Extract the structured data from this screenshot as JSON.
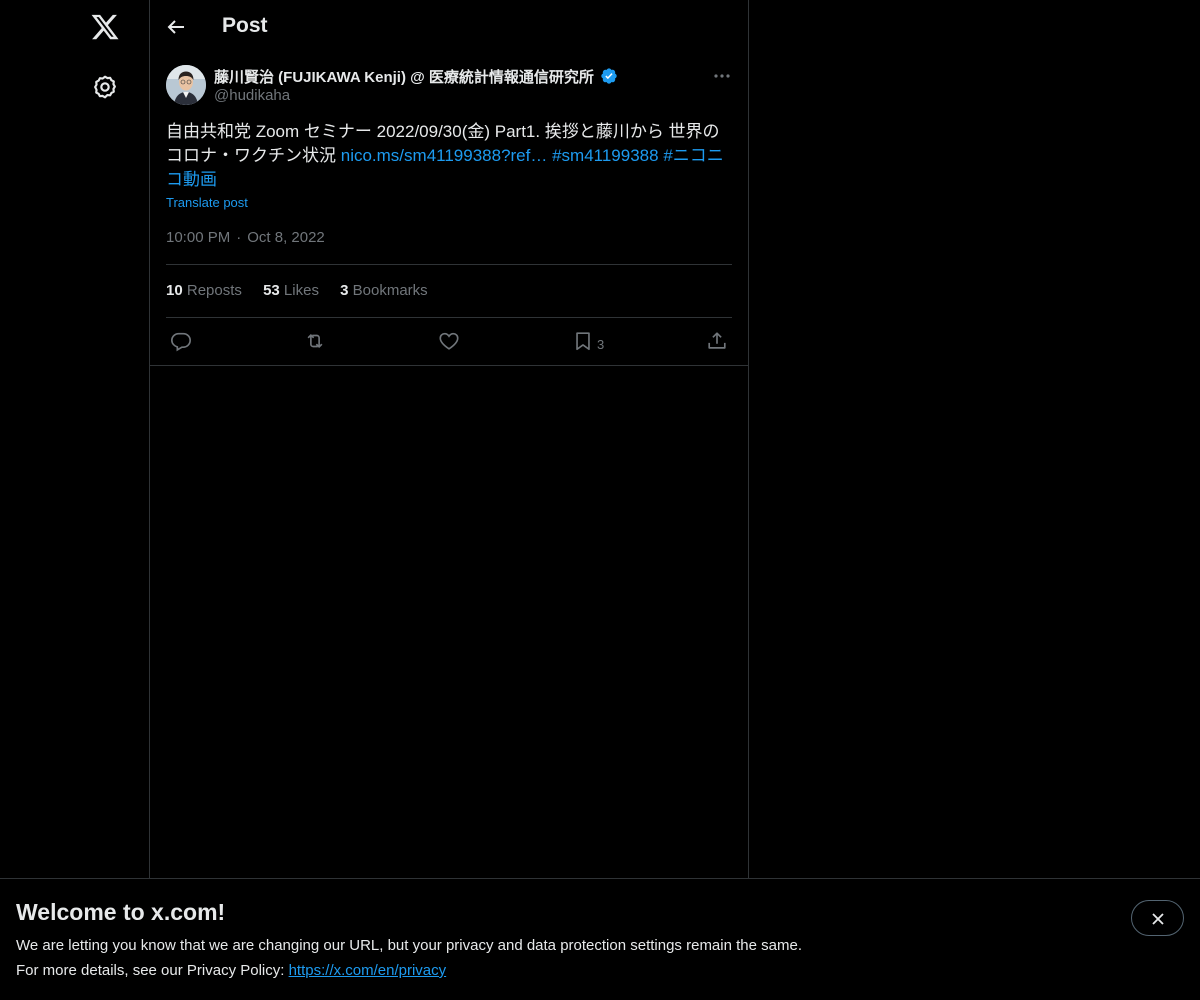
{
  "header": {
    "title": "Post"
  },
  "post": {
    "author_name": "藤川賢治 (FUJIKAWA Kenji) @ 医療統計情報通信研究所",
    "handle": "@hudikaha",
    "text_plain": "自由共和党 Zoom セミナー 2022/09/30(金) Part1. 挨拶と藤川から 世界のコロナ・ワクチン状況 ",
    "link_url": "nico.ms/sm41199388?ref…",
    "hashtag_1": "#sm41199388",
    "hashtag_2": "#ニコニコ動画",
    "translate_label": "Translate post",
    "time": "10:00 PM",
    "date": "Oct 8, 2022",
    "stats": {
      "reposts_count": "10",
      "reposts_label": "Reposts",
      "likes_count": "53",
      "likes_label": "Likes",
      "bookmarks_count": "3",
      "bookmarks_label": "Bookmarks"
    },
    "bookmark_action_count": "3"
  },
  "banner": {
    "title": "Welcome to x.com!",
    "line1": "We are letting you know that we are changing our URL, but your privacy and data protection settings remain the same.",
    "line2_prefix": "For more details, see our Privacy Policy: ",
    "privacy_link": "https://x.com/en/privacy"
  },
  "colors": {
    "accent": "#1d9bf0",
    "border": "#2f3336",
    "muted": "#71767b",
    "text": "#e7e9ea"
  },
  "icons": {
    "logo": "x-logo-icon",
    "settings": "gear-icon",
    "back": "arrow-left-icon",
    "verified": "verified-badge-icon",
    "more": "more-horizontal-icon",
    "reply": "reply-icon",
    "repost": "repost-icon",
    "like": "heart-icon",
    "bookmark": "bookmark-icon",
    "share": "share-icon",
    "close": "close-icon"
  }
}
